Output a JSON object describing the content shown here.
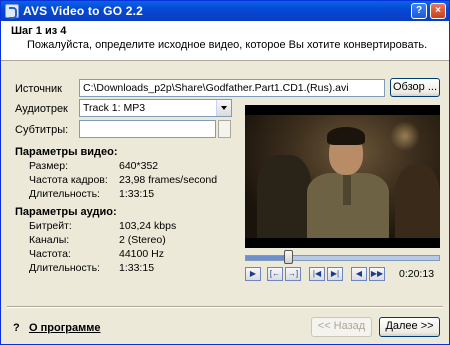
{
  "window": {
    "title": "AVS Video to GO  2.2",
    "help_glyph": "?",
    "close_glyph": "×"
  },
  "header": {
    "step": "Шаг 1 из 4",
    "description": "Пожалуйста, определите исходное видео, которое Вы хотите конвертировать."
  },
  "form": {
    "source_label": "Источник",
    "source_value": "C:\\Downloads_p2p\\Share\\Godfather.Part1.CD1.(Rus).avi",
    "browse_label": "Обзор ...",
    "audio_label": "Аудиотрек",
    "audio_value": "Track 1: MP3",
    "subtitles_label": "Субтитры:",
    "subtitles_value": ""
  },
  "video_params": {
    "title": "Параметры видео:",
    "size_label": "Размер:",
    "size_value": "640*352",
    "fps_label": "Частота кадров:",
    "fps_value": "23,98 frames/second",
    "duration_label": "Длительность:",
    "duration_value": "1:33:15"
  },
  "audio_params": {
    "title": "Параметры аудио:",
    "bitrate_label": "Битрейт:",
    "bitrate_value": "103,24 kbps",
    "channels_label": "Каналы:",
    "channels_value": "2 (Stereo)",
    "freq_label": "Частота:",
    "freq_value": "44100 Hz",
    "duration_label": "Длительность:",
    "duration_value": "1:33:15"
  },
  "player": {
    "position_fraction": 0.22,
    "time": "0:20:13",
    "play_glyph": "▶",
    "mark_in_glyph": "[←",
    "mark_out_glyph": "→]",
    "prev_glyph": "|◀",
    "next_glyph": "▶|",
    "step_back_glyph": "◀",
    "step_fwd_glyph": "▶▶"
  },
  "footer": {
    "help_glyph": "?",
    "about_label": "О программе",
    "back_label": "<< Назад",
    "next_label": "Далее >>"
  }
}
